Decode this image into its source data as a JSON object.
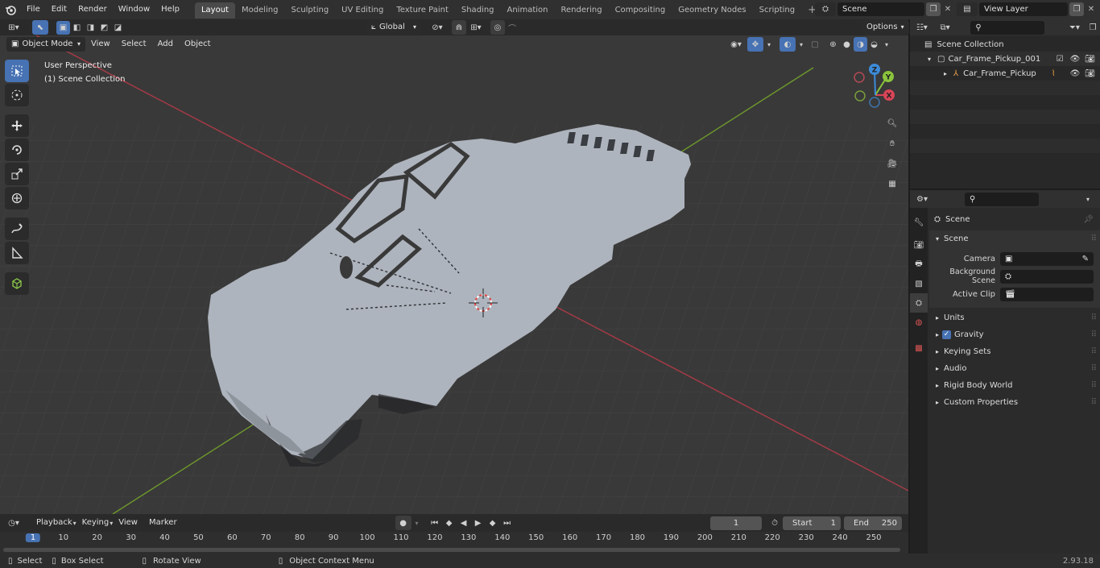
{
  "topbar": {
    "menus": [
      "File",
      "Edit",
      "Render",
      "Window",
      "Help"
    ],
    "workspaces": [
      "Layout",
      "Modeling",
      "Sculpting",
      "UV Editing",
      "Texture Paint",
      "Shading",
      "Animation",
      "Rendering",
      "Compositing",
      "Geometry Nodes",
      "Scripting"
    ],
    "active_workspace": "Layout",
    "scene_name": "Scene",
    "view_layer_name": "View Layer"
  },
  "viewport_header": {
    "orientation": "Global",
    "options_label": "Options",
    "mode": "Object Mode",
    "menus": [
      "View",
      "Select",
      "Add",
      "Object"
    ]
  },
  "viewport": {
    "perspective_label": "User Perspective",
    "collection_label": "(1) Scene Collection",
    "gizmo_axes": {
      "x": "X",
      "y": "Y",
      "z": "Z"
    }
  },
  "timeline": {
    "menus": [
      "Playback",
      "Keying",
      "View",
      "Marker"
    ],
    "current_frame": "1",
    "start_label": "Start",
    "start_value": "1",
    "end_label": "End",
    "end_value": "250",
    "ruler": [
      "1",
      "10",
      "20",
      "30",
      "40",
      "50",
      "60",
      "70",
      "80",
      "90",
      "100",
      "110",
      "120",
      "130",
      "140",
      "150",
      "160",
      "170",
      "180",
      "190",
      "200",
      "210",
      "220",
      "230",
      "240",
      "250"
    ]
  },
  "statusbar": {
    "select": "Select",
    "box_select": "Box Select",
    "rotate_view": "Rotate View",
    "context_menu": "Object Context Menu",
    "version": "2.93.18"
  },
  "outliner": {
    "root": "Scene Collection",
    "collection": "Car_Frame_Pickup_001",
    "object": "Car_Frame_Pickup"
  },
  "properties": {
    "context": "Scene",
    "section": "Scene",
    "camera_label": "Camera",
    "background_label": "Background Scene",
    "clip_label": "Active Clip",
    "panels": [
      "Units",
      "Gravity",
      "Keying Sets",
      "Audio",
      "Rigid Body World",
      "Custom Properties"
    ],
    "gravity_checked": true
  },
  "colors": {
    "accent": "#4772b3",
    "x_axis": "#d94457",
    "y_axis": "#8ac43c",
    "z_axis": "#3d8bd9",
    "mesh": "#aeb4bd"
  }
}
